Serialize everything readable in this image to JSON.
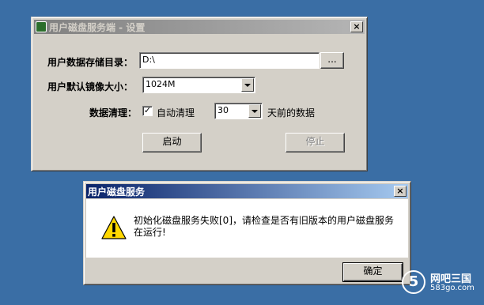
{
  "main_window": {
    "title": "用户磁盘服务端 - 设置",
    "close_label": "×",
    "storage_label": "用户数据存储目录：",
    "storage_value": "D:\\",
    "browse_label": "...",
    "image_size_label": "用户默认镜像大小：",
    "image_size_value": "1024M",
    "cleanup_label": "数据清理：",
    "auto_clean_label": "自动清理",
    "auto_clean_checked": "✓",
    "days_value": "30",
    "days_suffix": "天前的数据",
    "start_label": "启动",
    "stop_label": "停止"
  },
  "dialog": {
    "title": "用户磁盘服务",
    "close_label": "×",
    "message": "初始化磁盘服务失败[0]，请检查是否有旧版本的用户磁盘服务在运行!",
    "ok_label": "确定",
    "icon": "warning-icon"
  },
  "watermark": {
    "logo": "5",
    "name": "网吧三国",
    "url": "583go.com"
  },
  "colors": {
    "desktop": "#3a6ea5",
    "window": "#d4d0c8",
    "active_title": "#0a246a",
    "inactive_title": "#808080"
  }
}
